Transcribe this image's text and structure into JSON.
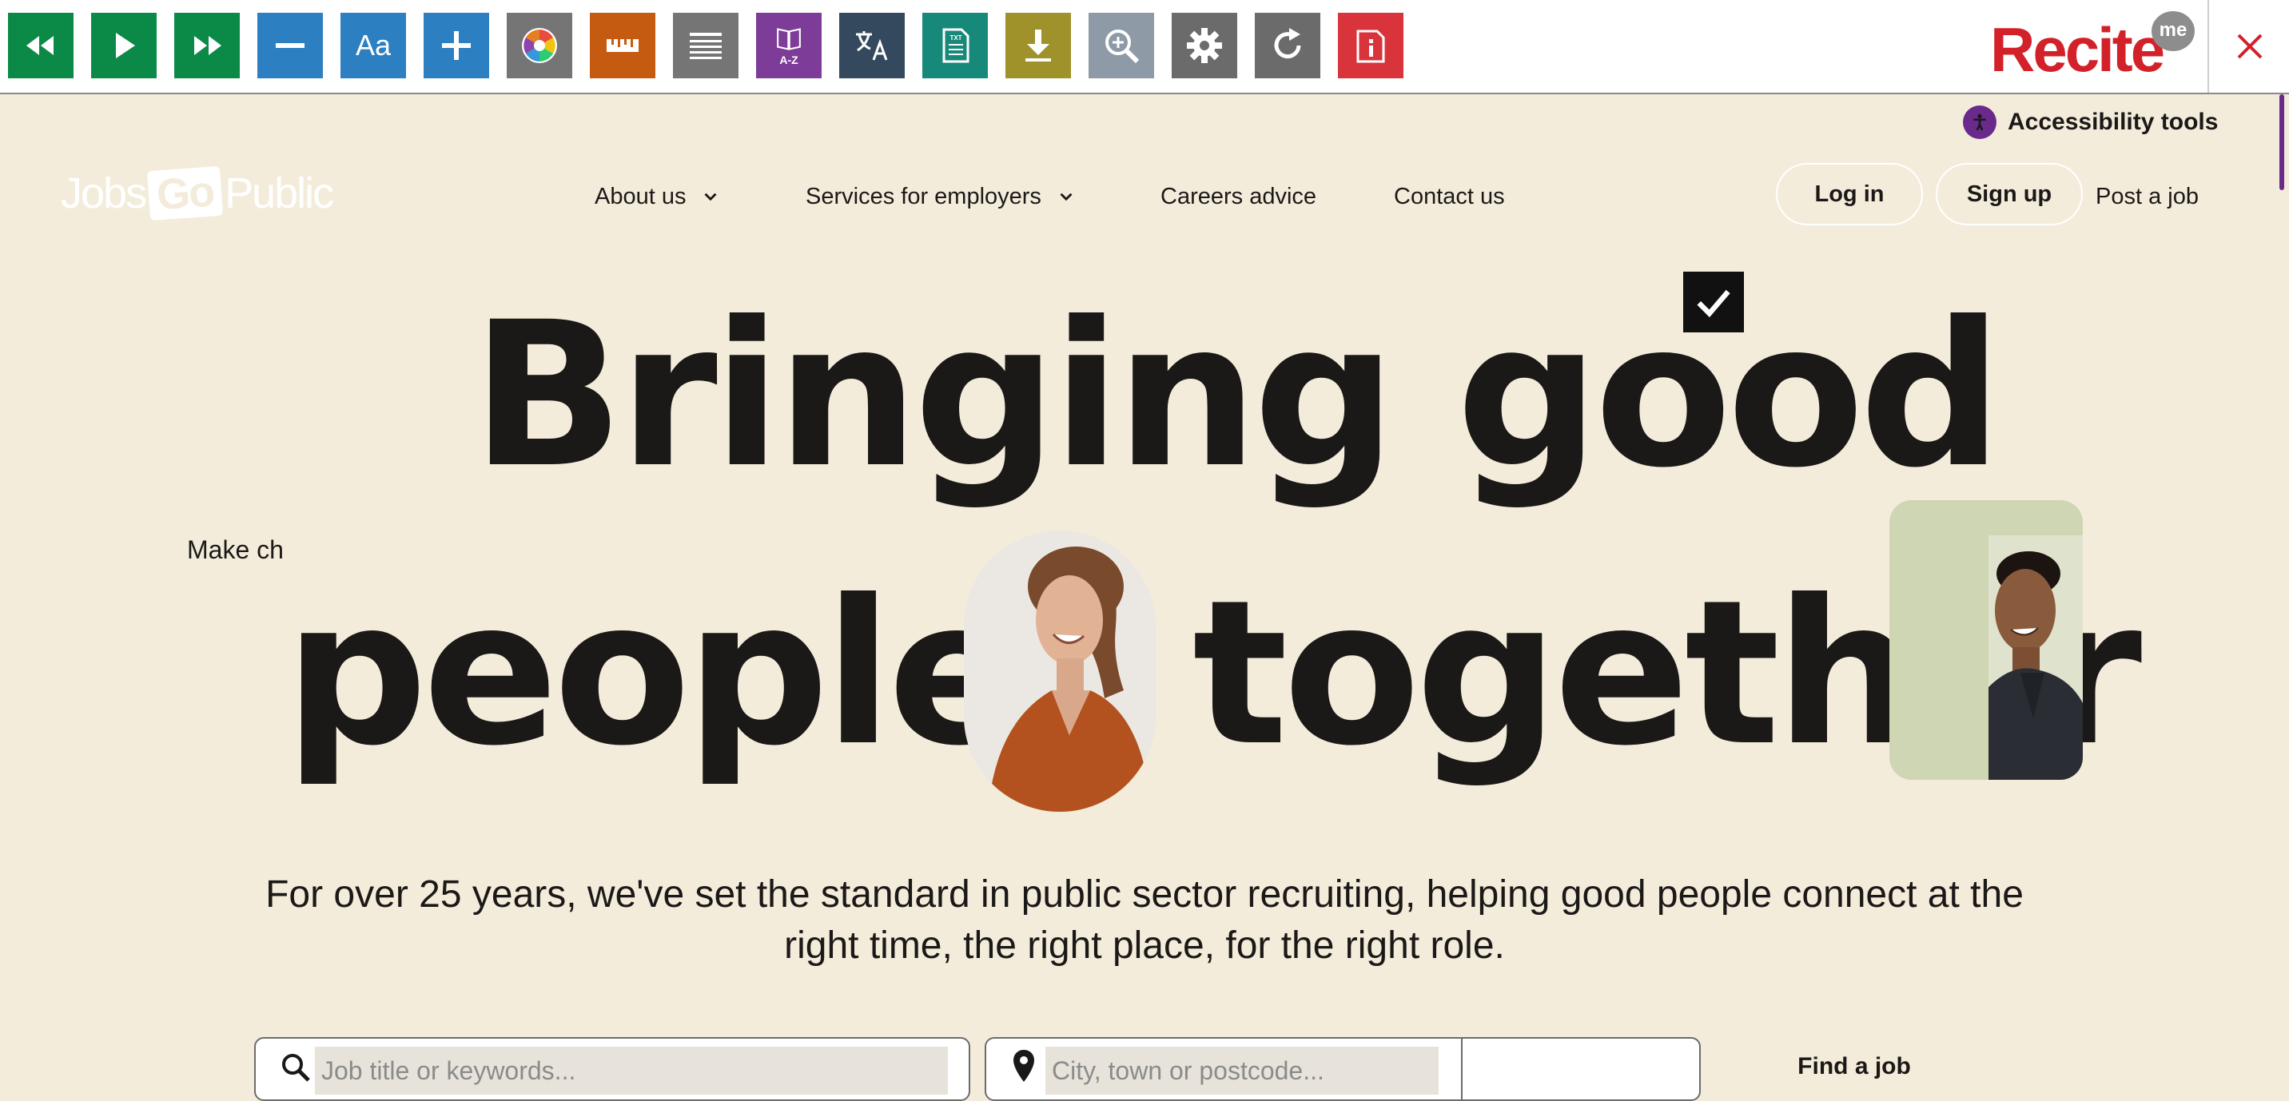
{
  "toolbar": {
    "tools": [
      {
        "icon": "rewind-icon",
        "color": "#0b8a47"
      },
      {
        "icon": "play-icon",
        "color": "#0b8a47"
      },
      {
        "icon": "fast-forward-icon",
        "color": "#0b8a47"
      },
      {
        "icon": "decrease-text-icon",
        "color": "#2c7fc1"
      },
      {
        "icon": "font-icon",
        "color": "#2c7fc1",
        "label": "Aa"
      },
      {
        "icon": "increase-text-icon",
        "color": "#2c7fc1"
      },
      {
        "icon": "color-wheel-icon",
        "color": "#757575"
      },
      {
        "icon": "ruler-icon",
        "color": "#c55a11"
      },
      {
        "icon": "text-mode-icon",
        "color": "#757575"
      },
      {
        "icon": "dictionary-icon",
        "color": "#7d3c98",
        "label": "A-Z"
      },
      {
        "icon": "translate-icon",
        "color": "#34495e"
      },
      {
        "icon": "text-file-icon",
        "color": "#17897a",
        "label": "TXT"
      },
      {
        "icon": "download-icon",
        "color": "#a0922a"
      },
      {
        "icon": "magnifier-icon",
        "color": "#8e9aa6"
      },
      {
        "icon": "settings-icon",
        "color": "#6b6b6b"
      },
      {
        "icon": "reset-icon",
        "color": "#6b6b6b"
      },
      {
        "icon": "info-icon",
        "color": "#d9343b"
      }
    ],
    "brand": "Recite",
    "brand_badge": "me"
  },
  "accessibility": {
    "label": "Accessibility tools"
  },
  "header": {
    "logo": {
      "left": "Jobs",
      "mid": "Go",
      "right": "Public"
    },
    "nav": {
      "about": "About us",
      "services": "Services for employers",
      "careers": "Careers advice",
      "contact": "Contact us"
    },
    "login": "Log in",
    "signup": "Sign up",
    "post_job": "Post a job"
  },
  "hero": {
    "line1": "Bringing good",
    "line2a": "people",
    "line2b": "together",
    "side_text": "Make ch",
    "lead": "For over 25 years, we've set the standard in public sector recruiting, helping good people connect at the right time, the right place, for the right role."
  },
  "search": {
    "keywords_placeholder": "Job title or keywords...",
    "location_placeholder": "City, town or postcode...",
    "find_label": "Find a job"
  }
}
